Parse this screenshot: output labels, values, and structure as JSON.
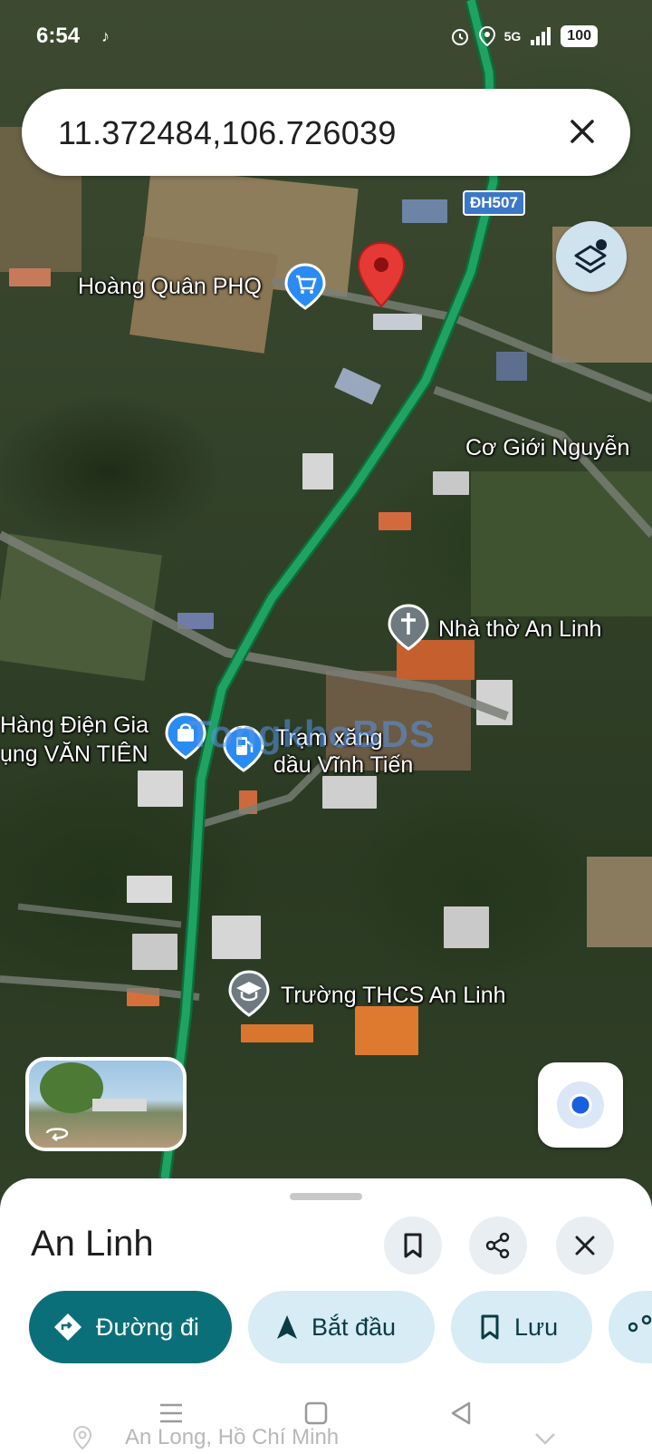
{
  "status_bar": {
    "time": "6:54",
    "network": "5G",
    "battery": "100",
    "icons": [
      "tiktok-icon",
      "alarm-icon",
      "location-icon",
      "signal-icon",
      "battery-icon"
    ]
  },
  "search": {
    "query": "11.372484,106.726039",
    "clear_icon": "close-icon"
  },
  "map": {
    "road_badge": "ĐH507",
    "labels": {
      "hoang_quan": "Hoàng Quân PHQ",
      "co_gioi": "Cơ Giới Nguyễn",
      "nha_tho": "Nhà thờ An Linh",
      "hang_dien_line1": "Hàng Điện Gia",
      "hang_dien_line2": "ụng VĂN TIÊN",
      "tram_xang_line1": "Trạm xăng",
      "tram_xang_line2": "dầu Vĩnh Tiến",
      "truong": "Trường THCS An Linh"
    },
    "watermark": "TongkhoBDS",
    "colors": {
      "pin": "#e53935",
      "route": "#1ea362",
      "poi_blue": "#2a8bf2",
      "poi_gray": "#6e7a80"
    }
  },
  "sheet": {
    "title": "An Linh",
    "actions": {
      "directions": "Đường đi",
      "start": "Bắt đầu",
      "save": "Lưu"
    },
    "peek_text": "An Long, Hồ Chí Minh"
  },
  "theme": {
    "primary": "#0b6f7a",
    "chip_secondary": "#d7ecf4",
    "icon_button_bg": "#e9eef3"
  }
}
